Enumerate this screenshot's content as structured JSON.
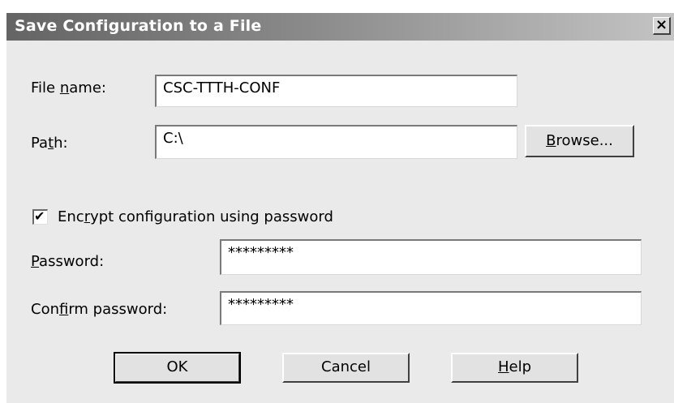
{
  "dialog": {
    "title": "Save Configuration to a File",
    "close_glyph": "×"
  },
  "file_name": {
    "label_pre": "File ",
    "label_accel": "n",
    "label_post": "ame:",
    "value": "CSC-TTTH-CONF"
  },
  "path": {
    "label_pre": "Pa",
    "label_accel": "t",
    "label_post": "h:",
    "value": "C:\\",
    "browse_accel": "B",
    "browse_rest": "rowse..."
  },
  "encrypt": {
    "checked": true,
    "check_glyph": "✔",
    "label_pre": "Enc",
    "label_accel": "r",
    "label_post": "ypt configuration using password"
  },
  "password": {
    "label_pre": "",
    "label_accel": "P",
    "label_post": "assword:",
    "value": "*********"
  },
  "confirm": {
    "label_pre": "Con",
    "label_accel": "f",
    "label_post": "irm password:",
    "value": "*********"
  },
  "buttons": {
    "ok": "OK",
    "cancel": "Cancel",
    "help_accel": "H",
    "help_rest": "elp"
  }
}
